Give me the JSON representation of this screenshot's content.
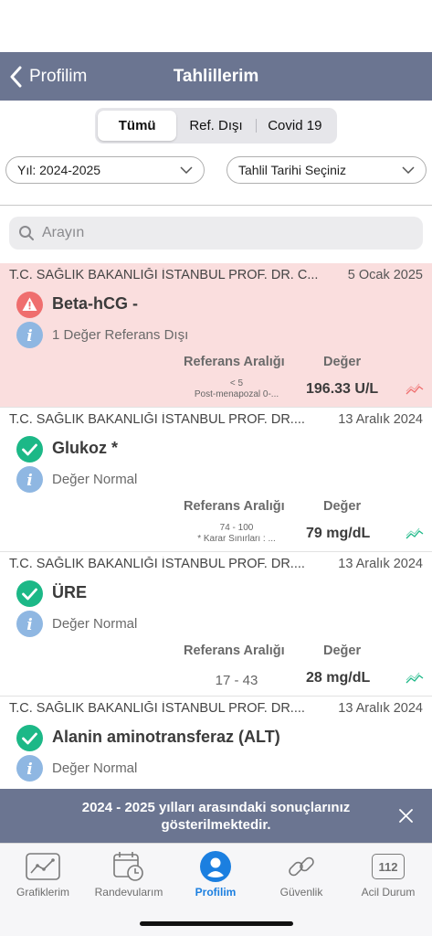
{
  "nav": {
    "back_label": "Profilim",
    "title": "Tahlillerim"
  },
  "segments": [
    "Tümü",
    "Ref. Dışı",
    "Covid 19"
  ],
  "filters": {
    "year": "Yıl: 2024-2025",
    "date": "Tahlil Tarihi Seçiniz"
  },
  "search": {
    "placeholder": "Arayın"
  },
  "list_headers": {
    "ref": "Referans Aralığı",
    "value": "Değer"
  },
  "results": [
    {
      "source": "T.C. SAĞLIK BAKANLIĞI İSTANBUL PROF. DR. C...",
      "date": "5 Ocak 2025",
      "name": "Beta-hCG -",
      "status": "1 Değer Referans Dışı",
      "ref_line1": "< 5",
      "ref_line2": "Post-menapozal 0-...",
      "value": "196.33 U/L"
    },
    {
      "source": "T.C. SAĞLIK BAKANLIĞI İSTANBUL PROF. DR....",
      "date": "13 Aralık 2024",
      "name": "Glukoz *",
      "status": "Değer Normal",
      "ref_line1": "74 - 100",
      "ref_line2": "* Karar Sınırları : ...",
      "value": "79 mg/dL"
    },
    {
      "source": "T.C. SAĞLIK BAKANLIĞI İSTANBUL PROF. DR....",
      "date": "13 Aralık 2024",
      "name": "ÜRE",
      "status": "Değer Normal",
      "ref_single": "17 - 43",
      "value": "28 mg/dL"
    },
    {
      "source": "T.C. SAĞLIK BAKANLIĞI İSTANBUL PROF. DR....",
      "date": "13 Aralık 2024",
      "name": "Alanin aminotransferaz (ALT)",
      "status": "Değer Normal"
    }
  ],
  "banner": {
    "text": "2024 - 2025 yılları arasındaki sonuçlarınız gösterilmektedir."
  },
  "tabs": {
    "graphs": "Grafiklerim",
    "appointments": "Randevularım",
    "profile": "Profilim",
    "security": "Güvenlik",
    "emergency": "Acil Durum",
    "emergency_number": "112"
  },
  "colors": {
    "nav": "#6b7591",
    "alert_bg": "#fadede",
    "alert_icon": "#ef6e6e",
    "ok_icon": "#1cb887",
    "info_icon": "#8fb7e2",
    "active_tab": "#1b7fe0"
  }
}
